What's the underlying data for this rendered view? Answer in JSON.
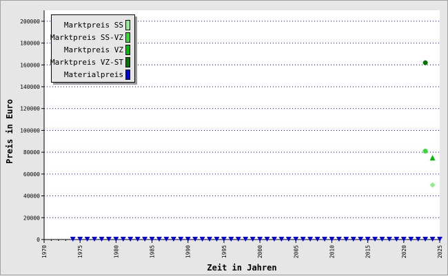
{
  "chart_data": {
    "type": "scatter",
    "xlabel": "Zeit in Jahren",
    "ylabel": "Preis in Euro",
    "xlim": [
      1970,
      2025
    ],
    "ylim": [
      0,
      210000
    ],
    "x_ticks": [
      "1970",
      "1975",
      "1980",
      "1985",
      "1990",
      "1995",
      "2000",
      "2005",
      "2010",
      "2015",
      "2020",
      "2025"
    ],
    "y_ticks": [
      "0",
      "20000",
      "40000",
      "60000",
      "80000",
      "100000",
      "120000",
      "140000",
      "160000",
      "180000",
      "200000"
    ],
    "grid": true,
    "legend_position": "top-left",
    "series": [
      {
        "name": "Marktpreis SS",
        "color": "#90ee90",
        "marker": "diamond",
        "points": [
          [
            2024,
            50000
          ]
        ]
      },
      {
        "name": "Marktpreis SS-VZ",
        "color": "#33dd33",
        "marker": "circle",
        "points": [
          [
            2023,
            81000
          ]
        ]
      },
      {
        "name": "Marktpreis VZ",
        "color": "#00bb00",
        "marker": "triangle-up",
        "points": [
          [
            2024,
            75000
          ]
        ]
      },
      {
        "name": "Marktpreis VZ-ST",
        "color": "#007700",
        "marker": "circle",
        "points": [
          [
            2023,
            162000
          ]
        ]
      },
      {
        "name": "Materialpreis",
        "color": "#0000dd",
        "marker": "triangle-down",
        "points": [
          [
            1974,
            0
          ],
          [
            1975,
            0
          ],
          [
            1976,
            0
          ],
          [
            1977,
            0
          ],
          [
            1978,
            0
          ],
          [
            1979,
            0
          ],
          [
            1980,
            0
          ],
          [
            1981,
            0
          ],
          [
            1982,
            0
          ],
          [
            1983,
            0
          ],
          [
            1984,
            0
          ],
          [
            1985,
            0
          ],
          [
            1986,
            0
          ],
          [
            1987,
            0
          ],
          [
            1988,
            0
          ],
          [
            1989,
            0
          ],
          [
            1990,
            0
          ],
          [
            1991,
            0
          ],
          [
            1992,
            0
          ],
          [
            1993,
            0
          ],
          [
            1994,
            0
          ],
          [
            1995,
            0
          ],
          [
            1996,
            0
          ],
          [
            1997,
            0
          ],
          [
            1998,
            0
          ],
          [
            1999,
            0
          ],
          [
            2000,
            0
          ],
          [
            2001,
            0
          ],
          [
            2002,
            0
          ],
          [
            2003,
            0
          ],
          [
            2004,
            0
          ],
          [
            2005,
            0
          ],
          [
            2006,
            0
          ],
          [
            2007,
            0
          ],
          [
            2008,
            0
          ],
          [
            2009,
            0
          ],
          [
            2010,
            0
          ],
          [
            2011,
            0
          ],
          [
            2012,
            0
          ],
          [
            2013,
            0
          ],
          [
            2014,
            0
          ],
          [
            2015,
            0
          ],
          [
            2016,
            0
          ],
          [
            2017,
            0
          ],
          [
            2018,
            0
          ],
          [
            2019,
            0
          ],
          [
            2020,
            0
          ],
          [
            2021,
            0
          ],
          [
            2022,
            0
          ],
          [
            2023,
            0
          ],
          [
            2024,
            0
          ],
          [
            2025,
            0
          ]
        ]
      }
    ]
  }
}
